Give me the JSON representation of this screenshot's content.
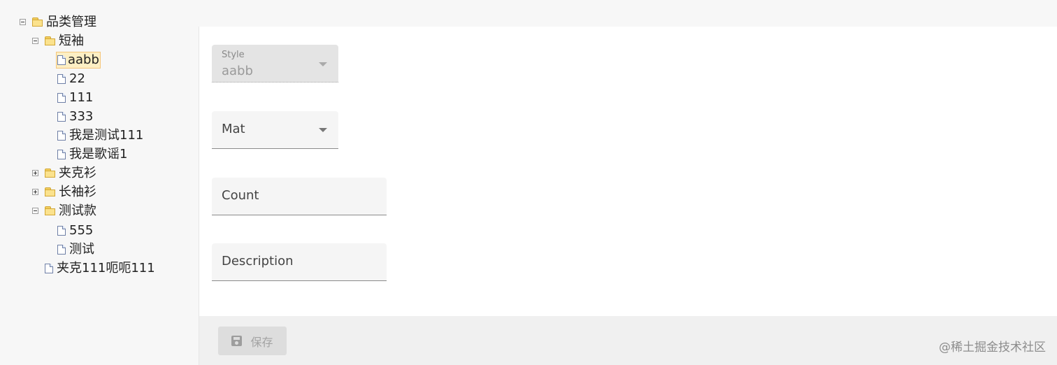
{
  "tree": {
    "root": {
      "label": "品类管理"
    },
    "short_sleeve": {
      "label": "短袖",
      "children": [
        "aabb",
        "22",
        "111",
        "333",
        "我是测试111",
        "我是歌谣1"
      ]
    },
    "jacket": {
      "label": "夹克衫"
    },
    "long_sleeve": {
      "label": "长袖衫"
    },
    "test_style": {
      "label": "测试款",
      "children": [
        "555",
        "测试"
      ]
    },
    "jacket_leaf": {
      "label": "夹克111呃呃111"
    },
    "selected": "aabb"
  },
  "form": {
    "style": {
      "label": "Style",
      "value": "aabb",
      "disabled": true
    },
    "mat": {
      "placeholder": "Mat"
    },
    "count": {
      "placeholder": "Count"
    },
    "description": {
      "placeholder": "Description"
    }
  },
  "footer": {
    "save_label": "保存",
    "save_icon": "floppy-disk-icon"
  },
  "watermark": "@稀土掘金技术社区",
  "colors": {
    "selection_bg": "#fdefc4",
    "folder": "#fbe28d",
    "panel_bg": "#ffffff",
    "page_bg": "#f7f7f7"
  }
}
